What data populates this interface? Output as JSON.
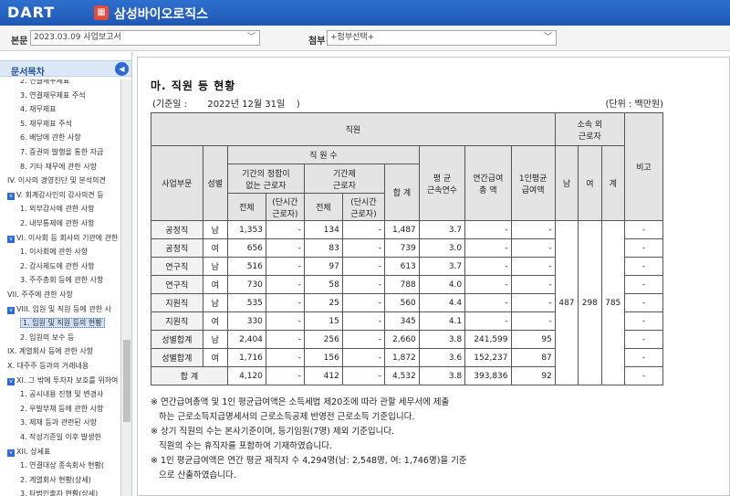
{
  "header": {
    "logo": "DART",
    "company": "삼성바이오로직스"
  },
  "selector": {
    "doc_label": "본문",
    "doc_value": "2023.03.09  사업보고서",
    "attach_label": "첨부",
    "attach_value": "+첨부선택+"
  },
  "sidebar": {
    "title": "문서목차",
    "items": [
      {
        "text": "2. 연결재무제표",
        "level": 1
      },
      {
        "text": "3. 연결재무제표 주석",
        "level": 1
      },
      {
        "text": "4. 재무제표",
        "level": 1
      },
      {
        "text": "5. 재무제표 주석",
        "level": 1
      },
      {
        "text": "6. 배당에 관한 사항",
        "level": 1
      },
      {
        "text": "7. 증권의 발행을 통한 자금",
        "level": 1
      },
      {
        "text": "8. 기타 재무에 관한 사항",
        "level": 1
      },
      {
        "text": "IV. 이사의 경영진단 및 분석의견",
        "level": 0
      },
      {
        "text": "V. 회계감사인의 감사의견 등",
        "level": 0,
        "box": true
      },
      {
        "text": "1. 외부감사에 관한 사항",
        "level": 1
      },
      {
        "text": "2. 내부통제에 관한 사항",
        "level": 1
      },
      {
        "text": "VI. 이사회 등 회사의 기관에 관한",
        "level": 0,
        "box": true
      },
      {
        "text": "1. 이사회에 관한 사항",
        "level": 1
      },
      {
        "text": "2. 감사제도에 관한 사항",
        "level": 1
      },
      {
        "text": "3. 주주총회 등에 관한 사항",
        "level": 1
      },
      {
        "text": "VII. 주주에 관한 사항",
        "level": 0
      },
      {
        "text": "VIII. 임원 및 직원 등에 관한 사",
        "level": 0,
        "box": true
      },
      {
        "text": "1. 임원 및 직원 등의 현황",
        "level": 1,
        "selected": true
      },
      {
        "text": "2. 임원의 보수 등",
        "level": 1
      },
      {
        "text": "IX. 계열회사 등에 관한 사항",
        "level": 0
      },
      {
        "text": "X. 대주주 등과의 거래내용",
        "level": 0
      },
      {
        "text": "XI. 그 밖에 투자자 보호를 위하여",
        "level": 0,
        "box": true
      },
      {
        "text": "1. 공시내용 진행 및 변경사",
        "level": 1
      },
      {
        "text": "2. 우발부채 등에 관한 사항",
        "level": 1
      },
      {
        "text": "3. 제재 등과 관련된 사항",
        "level": 1
      },
      {
        "text": "4. 작성기준일 이후 발생한",
        "level": 1
      },
      {
        "text": "XII. 상세표",
        "level": 0,
        "box": true
      },
      {
        "text": "1. 연결대상 종속회사 현황(",
        "level": 1
      },
      {
        "text": "2. 계열회사 현황(상세)",
        "level": 1
      },
      {
        "text": "3. 타법인출자 현황(상세)",
        "level": 1
      }
    ]
  },
  "main": {
    "title": "마. 직원 등 현황",
    "base_label": "(기준일 :",
    "base_date": "2022년 12월 31일",
    "base_close": ")",
    "unit": "(단위 : 백만원)",
    "headers": {
      "staff": "직원",
      "outside": "소속 외\n근로자",
      "remark": "비고",
      "division": "사업부문",
      "gender": "성별",
      "count": "직 원 수",
      "regular": "기간의 정함이\n없는 근로자",
      "contract": "기간제\n근로자",
      "total_count": "합 계",
      "avg_years": "평 균\n근속연수",
      "annual_pay": "연간급여\n총 액",
      "avg_pay": "1인평균\n급여액",
      "all": "전체",
      "part_time": "(단시간\n근로자)",
      "male": "남",
      "female": "여",
      "sum": "계"
    },
    "rows": [
      {
        "div": "공정직",
        "g": "남",
        "reg": "1,353",
        "reg_pt": "-",
        "con": "134",
        "con_pt": "-",
        "tot": "1,487",
        "yrs": "3.7",
        "pay": "-",
        "avg": "-",
        "note": "-"
      },
      {
        "div": "공정직",
        "g": "여",
        "reg": "656",
        "reg_pt": "-",
        "con": "83",
        "con_pt": "-",
        "tot": "739",
        "yrs": "3.0",
        "pay": "-",
        "avg": "-",
        "note": "-"
      },
      {
        "div": "연구직",
        "g": "남",
        "reg": "516",
        "reg_pt": "-",
        "con": "97",
        "con_pt": "-",
        "tot": "613",
        "yrs": "3.7",
        "pay": "-",
        "avg": "-",
        "note": "-"
      },
      {
        "div": "연구직",
        "g": "여",
        "reg": "730",
        "reg_pt": "-",
        "con": "58",
        "con_pt": "-",
        "tot": "788",
        "yrs": "4.0",
        "pay": "-",
        "avg": "-",
        "note": "-"
      },
      {
        "div": "지원직",
        "g": "남",
        "reg": "535",
        "reg_pt": "-",
        "con": "25",
        "con_pt": "-",
        "tot": "560",
        "yrs": "4.4",
        "pay": "-",
        "avg": "-",
        "note": "-"
      },
      {
        "div": "지원직",
        "g": "여",
        "reg": "330",
        "reg_pt": "-",
        "con": "15",
        "con_pt": "-",
        "tot": "345",
        "yrs": "4.1",
        "pay": "-",
        "avg": "-",
        "note": "-"
      },
      {
        "div": "성별합계",
        "g": "남",
        "reg": "2,404",
        "reg_pt": "-",
        "con": "256",
        "con_pt": "-",
        "tot": "2,660",
        "yrs": "3.8",
        "pay": "241,599",
        "avg": "95",
        "note": "-"
      },
      {
        "div": "성별합계",
        "g": "여",
        "reg": "1,716",
        "reg_pt": "-",
        "con": "156",
        "con_pt": "-",
        "tot": "1,872",
        "yrs": "3.6",
        "pay": "152,237",
        "avg": "87",
        "note": "-"
      }
    ],
    "total_row": {
      "label": "합 계",
      "reg": "4,120",
      "reg_pt": "-",
      "con": "412",
      "con_pt": "-",
      "tot": "4,532",
      "yrs": "3.8",
      "pay": "393,836",
      "avg": "92",
      "note": "-"
    },
    "outside": {
      "male": "487",
      "female": "298",
      "sum": "785"
    },
    "notes": [
      "※ 연간급여총액 및 1인 평균급여액은 소득세법 제20조에 따라 관할 세무서에 제출",
      "   하는 근로소득지급명세서의 근로소득공제 반영전 근로소득 기준입니다.",
      "※ 상기 직원의 수는 본사기준이며, 등기임원(7명) 제외 기준입니다.",
      "   직원의 수는 휴직자를 포함하여 기재하였습니다.",
      "※ 1인 평균급여액은 연간 평균 재직자 수 4,294명(남: 2,548명, 여: 1,746명)을 기준",
      "   으로 산출하였습니다."
    ]
  }
}
